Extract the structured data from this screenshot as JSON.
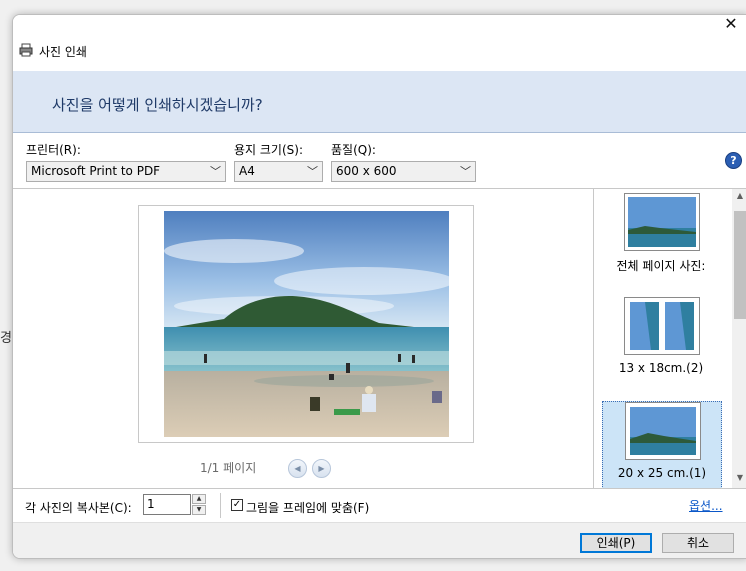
{
  "background": {
    "left_char": "경"
  },
  "window": {
    "title": "사진 인쇄",
    "close_symbol": "✕"
  },
  "header": {
    "question": "사진을 어떻게 인쇄하시겠습니까?"
  },
  "settings": {
    "printer": {
      "label": "프린터(R):",
      "value": "Microsoft Print to PDF"
    },
    "paper_size": {
      "label": "용지 크기(S):",
      "value": "A4"
    },
    "quality": {
      "label": "품질(Q):",
      "value": "600 x 600"
    },
    "help_symbol": "?"
  },
  "preview": {
    "page_indicator": "1/1 페이지",
    "prev_symbol": "◀",
    "next_symbol": "▶"
  },
  "layouts": [
    {
      "label": "전체 페이지 사진:"
    },
    {
      "label": "13 x 18cm.(2)"
    },
    {
      "label": "20 x 25 cm.(1)",
      "selected": true
    }
  ],
  "options": {
    "copies_label": "각 사진의 복사본(C):",
    "copies_value": "1",
    "fit_label": "그림을 프레임에 맞춤(F)",
    "fit_checked": true,
    "options_link": "옵션..."
  },
  "buttons": {
    "print": "인쇄(P)",
    "cancel": "취소"
  },
  "colors": {
    "header_band": "#dce6f4",
    "accent": "#0078d7",
    "link": "#0b57c8"
  }
}
